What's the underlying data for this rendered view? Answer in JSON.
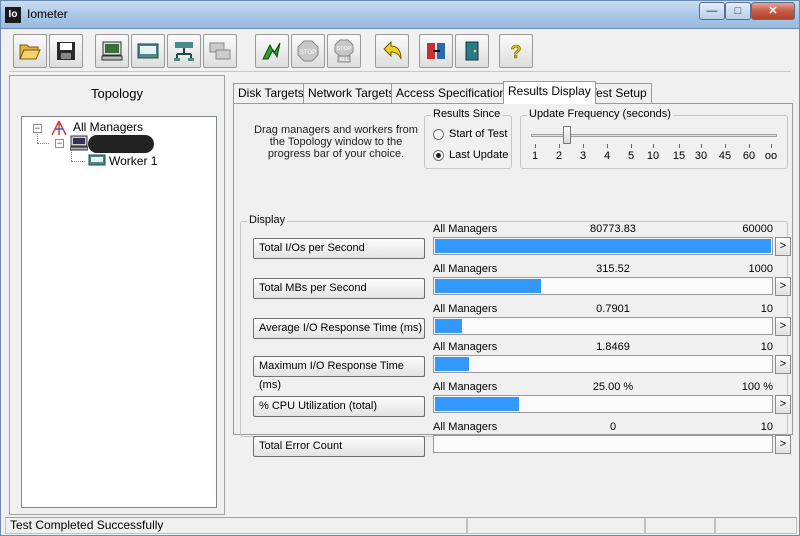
{
  "window": {
    "title": "Iometer",
    "app_icon_text": "Io",
    "minimize": "—",
    "maximize": "□",
    "close": "✕"
  },
  "toolbar": {
    "buttons": [
      {
        "name": "open-config-button",
        "icon": "folder-open-icon"
      },
      {
        "name": "save-config-button",
        "icon": "floppy-disk-icon"
      },
      {
        "name": "new-manager-button",
        "icon": "computer-icon"
      },
      {
        "name": "new-worker-button",
        "icon": "disk-worker-icon"
      },
      {
        "name": "new-network-worker-button",
        "icon": "network-worker-icon"
      },
      {
        "name": "duplicate-worker-button",
        "icon": "duplicate-icon"
      },
      {
        "name": "start-tests-button",
        "icon": "green-flag-icon"
      },
      {
        "name": "stop-button",
        "icon": "stop-sign-icon",
        "label": "STOP"
      },
      {
        "name": "stop-all-button",
        "icon": "stop-all-icon",
        "label": "STOP",
        "sublabel": "ALL"
      },
      {
        "name": "reset-workers-button",
        "icon": "reset-arrow-icon"
      },
      {
        "name": "exit-button",
        "icon": "exit-door-icon"
      },
      {
        "name": "about-button",
        "icon": "help-icon",
        "label": "?"
      }
    ]
  },
  "topology": {
    "title": "Topology",
    "root": {
      "label": "All Managers",
      "expander": "−"
    },
    "manager": {
      "expander": "−"
    },
    "worker": {
      "label": "Worker 1"
    }
  },
  "tabs": [
    {
      "label": "Disk Targets",
      "active": false
    },
    {
      "label": "Network Targets",
      "active": false
    },
    {
      "label": "Access Specifications",
      "active": false
    },
    {
      "label": "Results Display",
      "active": true
    },
    {
      "label": "Test Setup",
      "active": false
    }
  ],
  "results": {
    "instructions": "Drag managers and workers from the Topology window to the progress bar of your choice.",
    "results_since": {
      "label": "Results Since",
      "options": [
        {
          "label": "Start of Test",
          "checked": false
        },
        {
          "label": "Last Update",
          "checked": true
        }
      ]
    },
    "update_frequency": {
      "label": "Update Frequency (seconds)",
      "ticks": [
        "1",
        "2",
        "3",
        "4",
        "5",
        "10",
        "15",
        "30",
        "45",
        "60",
        "oo"
      ],
      "selected_index": 1
    },
    "display_label": "Display",
    "metrics": [
      {
        "button": "Total I/Os per Second",
        "manager": "All Managers",
        "value": "80773.83",
        "max": "60000",
        "fill": 1.0,
        "arrow": ">"
      },
      {
        "button": "Total MBs per Second",
        "manager": "All Managers",
        "value": "315.52",
        "max": "1000",
        "fill": 0.3155,
        "arrow": ">"
      },
      {
        "button": "Average I/O Response Time (ms)",
        "manager": "All Managers",
        "value": "0.7901",
        "max": "10",
        "fill": 0.079,
        "arrow": ">"
      },
      {
        "button": "Maximum I/O Response Time (ms)",
        "manager": "All Managers",
        "value": "1.8469",
        "max": "10",
        "fill": 0.1,
        "arrow": ">"
      },
      {
        "button": "% CPU Utilization (total)",
        "manager": "All Managers",
        "value": "25.00 %",
        "max": "100 %",
        "fill": 0.25,
        "arrow": ">"
      },
      {
        "button": "Total Error Count",
        "manager": "All Managers",
        "value": "0",
        "max": "10",
        "fill": 0,
        "arrow": ">"
      }
    ]
  },
  "status": {
    "text": "Test Completed Successfully"
  },
  "colors": {
    "accent": "#3399ff"
  }
}
